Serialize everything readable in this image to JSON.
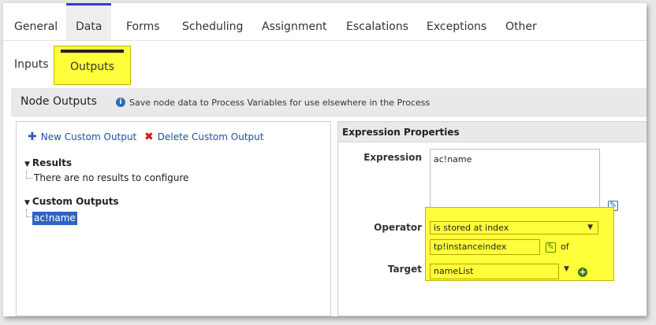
{
  "tabs": [
    {
      "label": "General"
    },
    {
      "label": "Data"
    },
    {
      "label": "Forms"
    },
    {
      "label": "Scheduling"
    },
    {
      "label": "Assignment"
    },
    {
      "label": "Escalations"
    },
    {
      "label": "Exceptions"
    },
    {
      "label": "Other"
    }
  ],
  "active_tab": "Data",
  "subtabs": {
    "inputs": "Inputs",
    "outputs": "Outputs"
  },
  "section": {
    "title": "Node Outputs",
    "info": "Save node data to Process Variables for use elsewhere in the Process"
  },
  "left_panel": {
    "new_label": "New Custom Output",
    "delete_label": "Delete Custom Output",
    "results_heading": "Results",
    "results_empty": "There are no results to configure",
    "custom_heading": "Custom Outputs",
    "custom_items": [
      "ac!name"
    ]
  },
  "right_panel": {
    "header": "Expression Properties",
    "expression_label": "Expression",
    "expression_value": "ac!name",
    "operator_label": "Operator",
    "operator_value": "is stored at index",
    "index_value": "tp!instanceindex",
    "of_text": "of",
    "target_label": "Target",
    "target_value": "nameList"
  },
  "colors": {
    "highlight": "#ffff3b",
    "active_tab_border": "#3a3ad6",
    "selection": "#2f64c4",
    "delete_icon": "#dd1111",
    "add_icon": "#3d7a10"
  },
  "icons": {
    "new": "plus-icon",
    "delete": "x-icon",
    "info": "info-icon",
    "edit": "edit-icon",
    "add": "add-circle-icon"
  }
}
